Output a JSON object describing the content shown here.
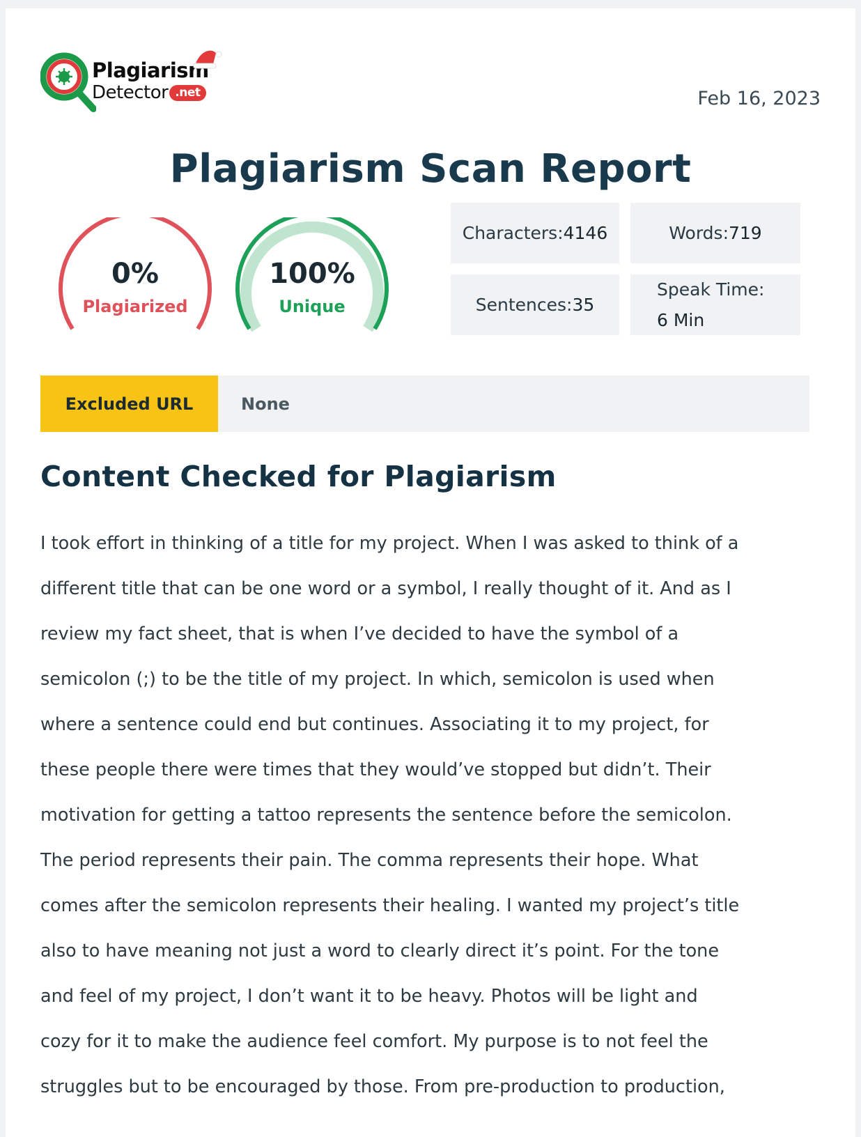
{
  "logo": {
    "line1": "Plagiarism",
    "line2": "Detector",
    "badge": ".net",
    "icon": "magnifier-logo-icon",
    "hat_icon": "santa-hat-icon",
    "colors": {
      "green": "#1c9a4a",
      "red": "#e23a3a"
    }
  },
  "header": {
    "date": "Feb 16, 2023"
  },
  "report": {
    "title": "Plagiarism Scan Report"
  },
  "gauges": {
    "plagiarized": {
      "percent": "0%",
      "label": "Plagiarized",
      "value": 0,
      "color": "#e0525a"
    },
    "unique": {
      "percent": "100%",
      "label": "Unique",
      "value": 100,
      "color": "#1da158",
      "track_color": "#bfe5cf"
    }
  },
  "stats": {
    "characters": {
      "label": "Characters:",
      "value": "4146"
    },
    "words": {
      "label": "Words:",
      "value": "719"
    },
    "sentences": {
      "label": "Sentences:",
      "value": "35"
    },
    "speak_time": {
      "label": "Speak Time:",
      "value": "6 Min"
    }
  },
  "excluded": {
    "label": "Excluded URL",
    "value": "None",
    "label_color": "#f7c416"
  },
  "content": {
    "heading": "Content Checked for Plagiarism",
    "lines": [
      "I took effort in thinking of a title for my project. When I was asked to think of a",
      "different title that can be one word or a symbol, I really thought of it. And as I",
      "review my fact sheet, that is when I’ve decided to have the symbol of a",
      "semicolon (;) to be the title of my project. In which, semicolon is used when",
      "where a sentence could end but continues. Associating it to my project, for",
      "these people there were times that they would’ve stopped but didn’t. Their",
      "motivation for getting a tattoo represents the sentence before the semicolon.",
      "The period represents their pain. The comma represents their hope. What",
      "comes after the semicolon represents their healing. I wanted my project’s title",
      "also to have meaning not just a word to clearly direct it’s point. For the tone",
      "and feel of my project, I don’t want it to be heavy. Photos will be light and",
      "cozy for it to make the audience feel comfort. My purpose is to not feel the",
      "struggles but to be encouraged by those. From pre-production to production,"
    ]
  }
}
